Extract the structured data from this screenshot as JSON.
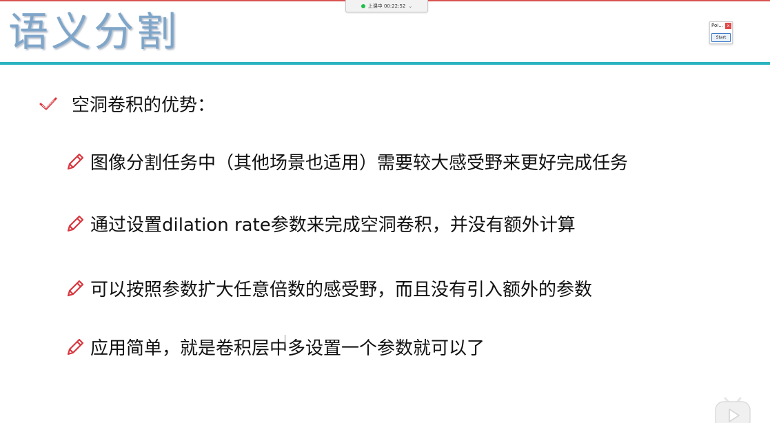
{
  "recording": {
    "status_text": "上课中 00:22:52",
    "indicator_color": "#1fbf4a"
  },
  "slide": {
    "title": "语义分割",
    "title_color": "#7fa6c9",
    "rule_color": "#2bb3c0",
    "heading": "空洞卷积的优势：",
    "bullets": [
      "图像分割任务中（其他场景也适用）需要较大感受野来更好完成任务",
      "通过设置dilation rate参数来完成空洞卷积，并没有额外计算",
      "可以按照参数扩大任意倍数的感受野，而且没有引入额外的参数",
      "应用简单，就是卷积层中多设置一个参数就可以了"
    ]
  },
  "mini_window": {
    "title": "Poi...",
    "close_label": "x",
    "start_label": "Start"
  },
  "icons": {
    "heading_icon": "check-icon",
    "bullet_icon": "pencil-icon",
    "overlay_icon": "play-icon",
    "accent_red": "#d9363e"
  }
}
